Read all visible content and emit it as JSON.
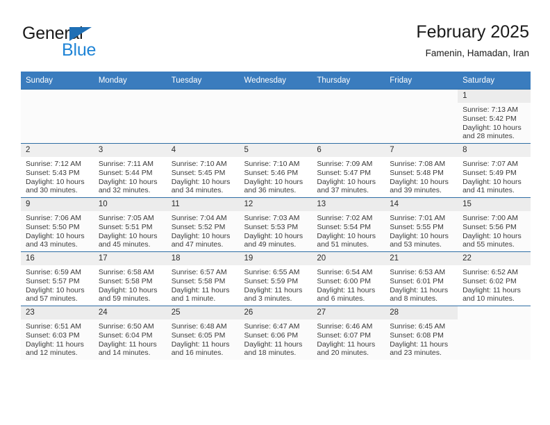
{
  "brand": {
    "name_part1": "General",
    "name_part2": "Blue",
    "triangle_icon": "triangle-icon",
    "color_dark": "#1a1a1a",
    "color_blue": "#1f84d6"
  },
  "header": {
    "title": "February 2025",
    "subtitle": "Famenin, Hamadan, Iran"
  },
  "theme": {
    "header_row_bg": "#3a7cbe",
    "header_row_text": "#ffffff",
    "row_divider": "#2e6da4",
    "daynum_band": "#efefef"
  },
  "calendar": {
    "weekday_headers": [
      "Sunday",
      "Monday",
      "Tuesday",
      "Wednesday",
      "Thursday",
      "Friday",
      "Saturday"
    ],
    "weeks": [
      [
        {
          "day": "",
          "sunrise": "",
          "sunset": "",
          "daylight": "",
          "blank": true
        },
        {
          "day": "",
          "sunrise": "",
          "sunset": "",
          "daylight": "",
          "blank": true
        },
        {
          "day": "",
          "sunrise": "",
          "sunset": "",
          "daylight": "",
          "blank": true
        },
        {
          "day": "",
          "sunrise": "",
          "sunset": "",
          "daylight": "",
          "blank": true
        },
        {
          "day": "",
          "sunrise": "",
          "sunset": "",
          "daylight": "",
          "blank": true
        },
        {
          "day": "",
          "sunrise": "",
          "sunset": "",
          "daylight": "",
          "blank": true
        },
        {
          "day": "1",
          "sunrise": "Sunrise: 7:13 AM",
          "sunset": "Sunset: 5:42 PM",
          "daylight": "Daylight: 10 hours and 28 minutes."
        }
      ],
      [
        {
          "day": "2",
          "sunrise": "Sunrise: 7:12 AM",
          "sunset": "Sunset: 5:43 PM",
          "daylight": "Daylight: 10 hours and 30 minutes."
        },
        {
          "day": "3",
          "sunrise": "Sunrise: 7:11 AM",
          "sunset": "Sunset: 5:44 PM",
          "daylight": "Daylight: 10 hours and 32 minutes."
        },
        {
          "day": "4",
          "sunrise": "Sunrise: 7:10 AM",
          "sunset": "Sunset: 5:45 PM",
          "daylight": "Daylight: 10 hours and 34 minutes."
        },
        {
          "day": "5",
          "sunrise": "Sunrise: 7:10 AM",
          "sunset": "Sunset: 5:46 PM",
          "daylight": "Daylight: 10 hours and 36 minutes."
        },
        {
          "day": "6",
          "sunrise": "Sunrise: 7:09 AM",
          "sunset": "Sunset: 5:47 PM",
          "daylight": "Daylight: 10 hours and 37 minutes."
        },
        {
          "day": "7",
          "sunrise": "Sunrise: 7:08 AM",
          "sunset": "Sunset: 5:48 PM",
          "daylight": "Daylight: 10 hours and 39 minutes."
        },
        {
          "day": "8",
          "sunrise": "Sunrise: 7:07 AM",
          "sunset": "Sunset: 5:49 PM",
          "daylight": "Daylight: 10 hours and 41 minutes."
        }
      ],
      [
        {
          "day": "9",
          "sunrise": "Sunrise: 7:06 AM",
          "sunset": "Sunset: 5:50 PM",
          "daylight": "Daylight: 10 hours and 43 minutes."
        },
        {
          "day": "10",
          "sunrise": "Sunrise: 7:05 AM",
          "sunset": "Sunset: 5:51 PM",
          "daylight": "Daylight: 10 hours and 45 minutes."
        },
        {
          "day": "11",
          "sunrise": "Sunrise: 7:04 AM",
          "sunset": "Sunset: 5:52 PM",
          "daylight": "Daylight: 10 hours and 47 minutes."
        },
        {
          "day": "12",
          "sunrise": "Sunrise: 7:03 AM",
          "sunset": "Sunset: 5:53 PM",
          "daylight": "Daylight: 10 hours and 49 minutes."
        },
        {
          "day": "13",
          "sunrise": "Sunrise: 7:02 AM",
          "sunset": "Sunset: 5:54 PM",
          "daylight": "Daylight: 10 hours and 51 minutes."
        },
        {
          "day": "14",
          "sunrise": "Sunrise: 7:01 AM",
          "sunset": "Sunset: 5:55 PM",
          "daylight": "Daylight: 10 hours and 53 minutes."
        },
        {
          "day": "15",
          "sunrise": "Sunrise: 7:00 AM",
          "sunset": "Sunset: 5:56 PM",
          "daylight": "Daylight: 10 hours and 55 minutes."
        }
      ],
      [
        {
          "day": "16",
          "sunrise": "Sunrise: 6:59 AM",
          "sunset": "Sunset: 5:57 PM",
          "daylight": "Daylight: 10 hours and 57 minutes."
        },
        {
          "day": "17",
          "sunrise": "Sunrise: 6:58 AM",
          "sunset": "Sunset: 5:58 PM",
          "daylight": "Daylight: 10 hours and 59 minutes."
        },
        {
          "day": "18",
          "sunrise": "Sunrise: 6:57 AM",
          "sunset": "Sunset: 5:58 PM",
          "daylight": "Daylight: 11 hours and 1 minute."
        },
        {
          "day": "19",
          "sunrise": "Sunrise: 6:55 AM",
          "sunset": "Sunset: 5:59 PM",
          "daylight": "Daylight: 11 hours and 3 minutes."
        },
        {
          "day": "20",
          "sunrise": "Sunrise: 6:54 AM",
          "sunset": "Sunset: 6:00 PM",
          "daylight": "Daylight: 11 hours and 6 minutes."
        },
        {
          "day": "21",
          "sunrise": "Sunrise: 6:53 AM",
          "sunset": "Sunset: 6:01 PM",
          "daylight": "Daylight: 11 hours and 8 minutes."
        },
        {
          "day": "22",
          "sunrise": "Sunrise: 6:52 AM",
          "sunset": "Sunset: 6:02 PM",
          "daylight": "Daylight: 11 hours and 10 minutes."
        }
      ],
      [
        {
          "day": "23",
          "sunrise": "Sunrise: 6:51 AM",
          "sunset": "Sunset: 6:03 PM",
          "daylight": "Daylight: 11 hours and 12 minutes."
        },
        {
          "day": "24",
          "sunrise": "Sunrise: 6:50 AM",
          "sunset": "Sunset: 6:04 PM",
          "daylight": "Daylight: 11 hours and 14 minutes."
        },
        {
          "day": "25",
          "sunrise": "Sunrise: 6:48 AM",
          "sunset": "Sunset: 6:05 PM",
          "daylight": "Daylight: 11 hours and 16 minutes."
        },
        {
          "day": "26",
          "sunrise": "Sunrise: 6:47 AM",
          "sunset": "Sunset: 6:06 PM",
          "daylight": "Daylight: 11 hours and 18 minutes."
        },
        {
          "day": "27",
          "sunrise": "Sunrise: 6:46 AM",
          "sunset": "Sunset: 6:07 PM",
          "daylight": "Daylight: 11 hours and 20 minutes."
        },
        {
          "day": "28",
          "sunrise": "Sunrise: 6:45 AM",
          "sunset": "Sunset: 6:08 PM",
          "daylight": "Daylight: 11 hours and 23 minutes."
        },
        {
          "day": "",
          "sunrise": "",
          "sunset": "",
          "daylight": "",
          "blank": true
        }
      ]
    ]
  }
}
